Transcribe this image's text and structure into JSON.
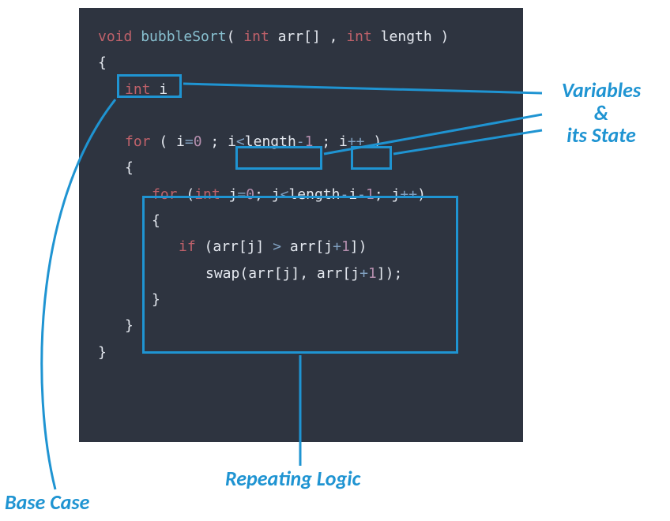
{
  "code": {
    "l1": {
      "void": "void",
      "fn": " bubbleSort",
      "p1": "( ",
      "int1": "int",
      "arr": " arr[] ",
      "comma": ",",
      "sp": " ",
      "int2": "int",
      "len": " length ",
      "p2": ")"
    },
    "l2": "{",
    "l3": {
      "int": "int",
      "i": " i ",
      "semi": ";"
    },
    "l4": {
      "for": "for",
      "open": " ( i",
      "eq1": "=",
      "zero": "0",
      "sep1": " ; ",
      "cond_i": "i",
      "lt": "<",
      "cond_len": "length",
      "minus": "-",
      "one": "1",
      "sep2": " ; ",
      "inc_i": "i",
      "pp": "++",
      "close": " )"
    },
    "l5": "{",
    "l6": {
      "for": "for",
      "open": " (",
      "int": "int",
      "j": " j",
      "eq": "=",
      "zero": "0",
      "sep1": "; j",
      "lt": "<",
      "len": "length",
      "minus1": "-",
      "i": "i",
      "minus2": "-",
      "one": "1",
      "sep2": "; j",
      "pp": "++",
      "close": ")"
    },
    "l7": "{",
    "l8": {
      "if": "if",
      "open": " (arr[j] ",
      "gt": ">",
      "mid": " arr[j",
      "plus": "+",
      "one": "1",
      "close": "])"
    },
    "l9": {
      "fn": "swap",
      "open": "(arr[j], arr[j",
      "plus": "+",
      "one": "1",
      "close": "]);"
    },
    "l10": "}",
    "l11": "}",
    "l12": "}"
  },
  "labels": {
    "variables": "Variables\n&\nits State",
    "base_case": "Base Case",
    "repeating": "Repeating Logic"
  },
  "colors": {
    "annotation": "#1f94d2",
    "background": "#2e3440",
    "keyword_red": "#bf616a",
    "function_cyan": "#88c0d0",
    "number_purple": "#b48ead",
    "operator": "#81a1c1",
    "text": "#e5e9f0"
  }
}
